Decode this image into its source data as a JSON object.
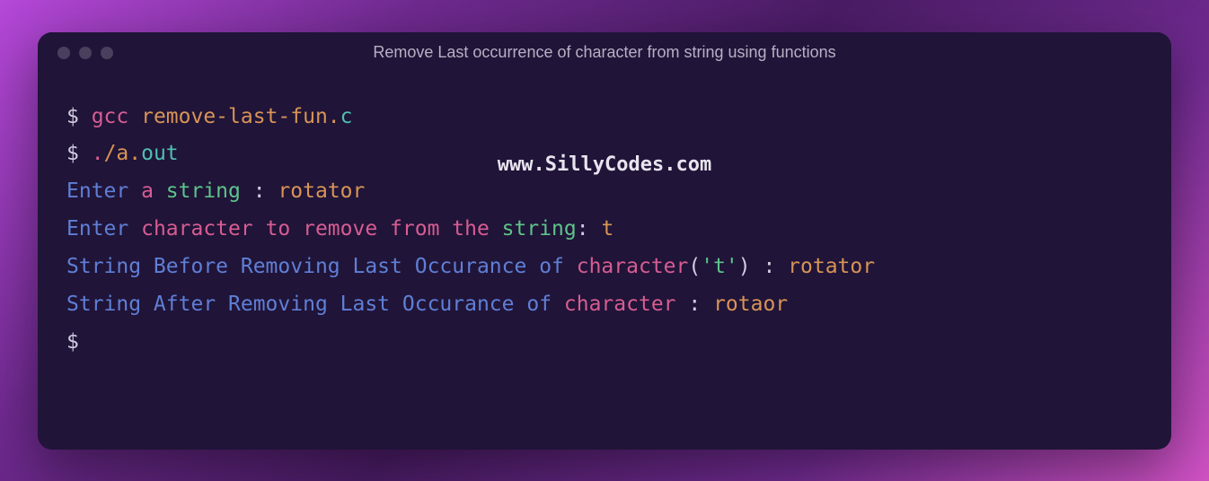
{
  "window": {
    "title": "Remove Last occurrence of character from string using functions"
  },
  "watermark": "www.SillyCodes.com",
  "lines": {
    "l1": {
      "prompt": "$ ",
      "cmd": "gcc",
      "args1": " remove-last-fun.",
      "args2": "c"
    },
    "l2": {
      "prompt": "$ ",
      "dot": ".",
      "slash": "/a.",
      "out": "out"
    },
    "l3": {
      "word1": "Enter",
      "word2": " a ",
      "word3": "string",
      "colon": " : ",
      "value": "rotator"
    },
    "l4": {
      "word1": "Enter",
      "word2": " character to remove from the ",
      "word3": "string",
      "colon": ": ",
      "value": "t"
    },
    "l5": {
      "prefix": "String Before Removing Last Occurance of ",
      "char": "character",
      "paren": "(",
      "quote": "'t'",
      "close": ") : ",
      "value": "rotator"
    },
    "l6": {
      "prefix": "String After Removing Last Occurance of ",
      "char": "character",
      "colon": " : ",
      "value": "rotaor"
    },
    "l7": {
      "prompt": "$ "
    }
  }
}
